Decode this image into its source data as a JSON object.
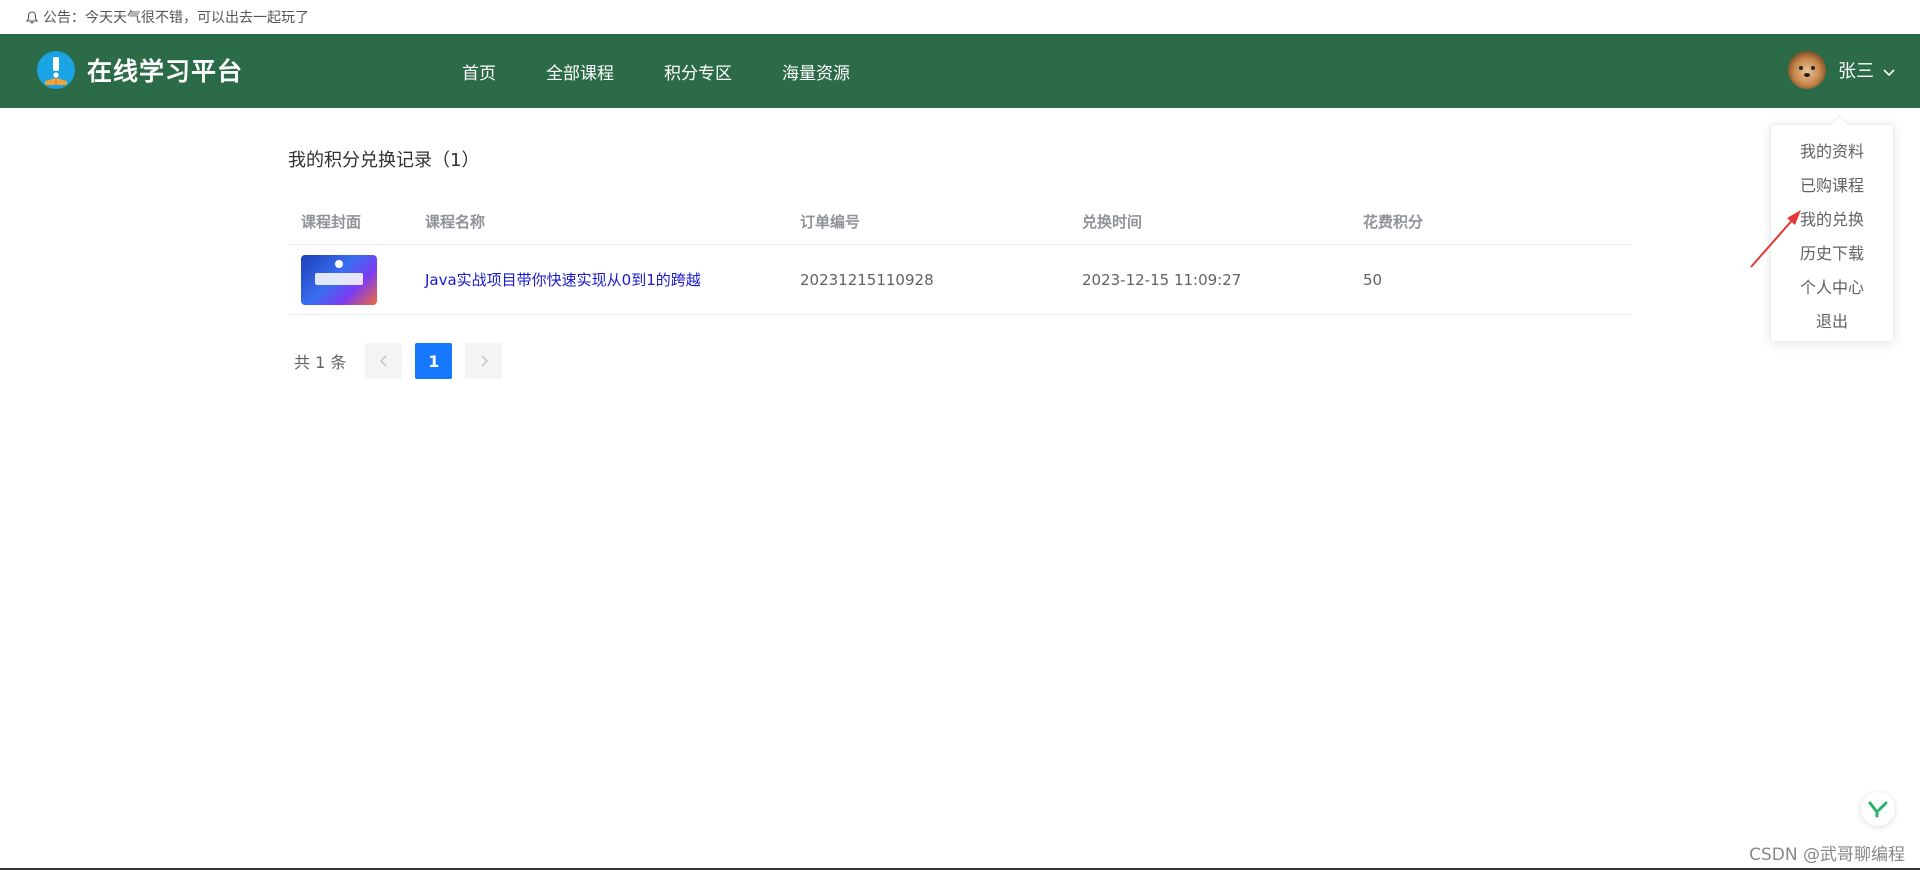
{
  "announcement": {
    "text": "公告：今天天气很不错，可以出去一起玩了"
  },
  "header": {
    "logo_title": "在线学习平台",
    "nav": [
      "首页",
      "全部课程",
      "积分专区",
      "海量资源"
    ],
    "user_name": "张三"
  },
  "user_menu": {
    "items": [
      "我的资料",
      "已购课程",
      "我的兑换",
      "历史下载",
      "个人中心",
      "退出"
    ]
  },
  "main": {
    "title": "我的积分兑换记录（1）",
    "columns": [
      "课程封面",
      "课程名称",
      "订单编号",
      "兑换时间",
      "花费积分"
    ],
    "rows": [
      {
        "course_name": "Java实战项目带你快速实现从0到1的跨越",
        "order_no": "20231215110928",
        "time": "2023-12-15 11:09:27",
        "points": "50"
      }
    ]
  },
  "pagination": {
    "total": "共 1 条",
    "current": "1"
  },
  "watermark": "CSDN @武哥聊编程",
  "colors": {
    "header_bg": "#2c6b47",
    "primary": "#1677ff",
    "link": "#1a1acc",
    "annotation": "#e53935"
  }
}
